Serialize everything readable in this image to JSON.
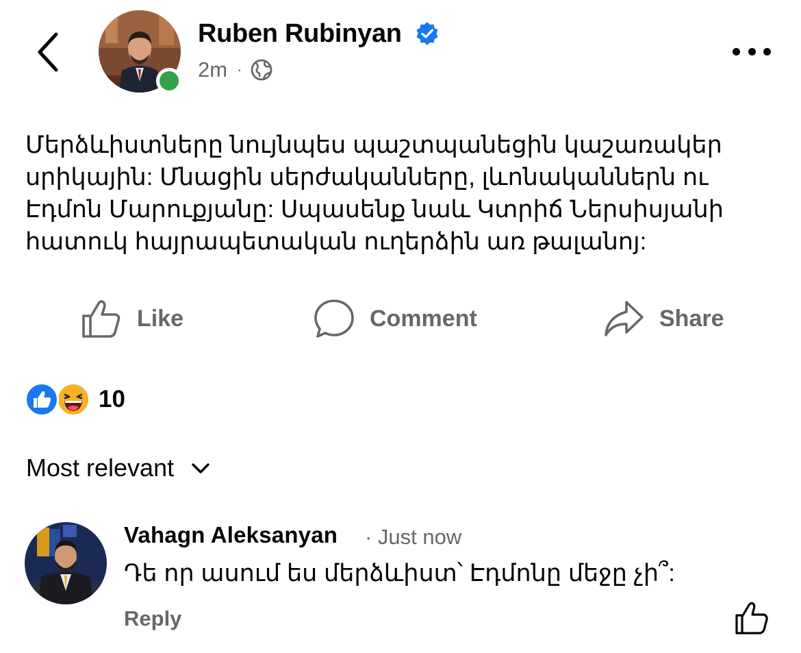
{
  "post": {
    "author": "Ruben Rubinyan",
    "time": "2m",
    "separator": "·",
    "text_lines": [
      "Մերձևիստները նույնպես պաշտպանեցին կաշառակեր",
      "սրիկային: Մնացին սերժականները, լևոնականներն ու",
      "Էդմոն Մարուքյանը: Սպասենք նաև Կտրիճ Ներսիսյանի",
      "հատուկ հայրապետական ուղերձին առ թալանոյ:"
    ]
  },
  "actions": {
    "like": "Like",
    "comment": "Comment",
    "share": "Share"
  },
  "reactions": {
    "count": "10",
    "types": [
      "like-icon",
      "haha-icon"
    ]
  },
  "comments_sort": {
    "label": "Most relevant"
  },
  "comment": {
    "author": "Vahagn Aleksanyan",
    "time": "· Just now",
    "text": "Դե որ ասում ես մերձևիստ՝ Էդմոնը մեջը չի՞:",
    "reply": "Reply"
  },
  "colors": {
    "accent": "#1877f2",
    "online": "#31a24c",
    "secondary_text": "#65676b",
    "haha": "#f7b125"
  }
}
